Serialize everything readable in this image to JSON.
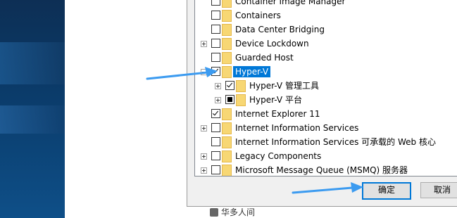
{
  "tree": {
    "items": [
      {
        "label": "Container Image Manager",
        "checked": "none",
        "expandable": false,
        "indent": 0
      },
      {
        "label": "Containers",
        "checked": "none",
        "expandable": false,
        "indent": 0
      },
      {
        "label": "Data Center Bridging",
        "checked": "none",
        "expandable": false,
        "indent": 0
      },
      {
        "label": "Device Lockdown",
        "checked": "none",
        "expandable": true,
        "indent": 0
      },
      {
        "label": "Guarded Host",
        "checked": "none",
        "expandable": false,
        "indent": 0
      },
      {
        "label": "Hyper-V",
        "checked": "checked",
        "expandable": true,
        "expanded": true,
        "selected": true,
        "indent": 0
      },
      {
        "label": "Hyper-V 管理工具",
        "checked": "checked",
        "expandable": true,
        "indent": 1
      },
      {
        "label": "Hyper-V 平台",
        "checked": "partial",
        "expandable": true,
        "indent": 1
      },
      {
        "label": "Internet Explorer 11",
        "checked": "checked",
        "expandable": false,
        "indent": 0
      },
      {
        "label": "Internet Information Services",
        "checked": "none",
        "expandable": true,
        "indent": 0
      },
      {
        "label": "Internet Information Services 可承载的 Web 核心",
        "checked": "none",
        "expandable": false,
        "indent": 0
      },
      {
        "label": "Legacy Components",
        "checked": "none",
        "expandable": true,
        "indent": 0
      },
      {
        "label": "Microsoft Message Queue (MSMQ) 服务器",
        "checked": "none",
        "expandable": true,
        "indent": 0
      }
    ]
  },
  "buttons": {
    "ok_label": "确定",
    "cancel_label": "取消"
  },
  "taskbar_fragment": {
    "text": "华多人间"
  },
  "colors": {
    "selection": "#0078d7",
    "arrow": "#3c9bf0",
    "folder": "#f7d774"
  }
}
